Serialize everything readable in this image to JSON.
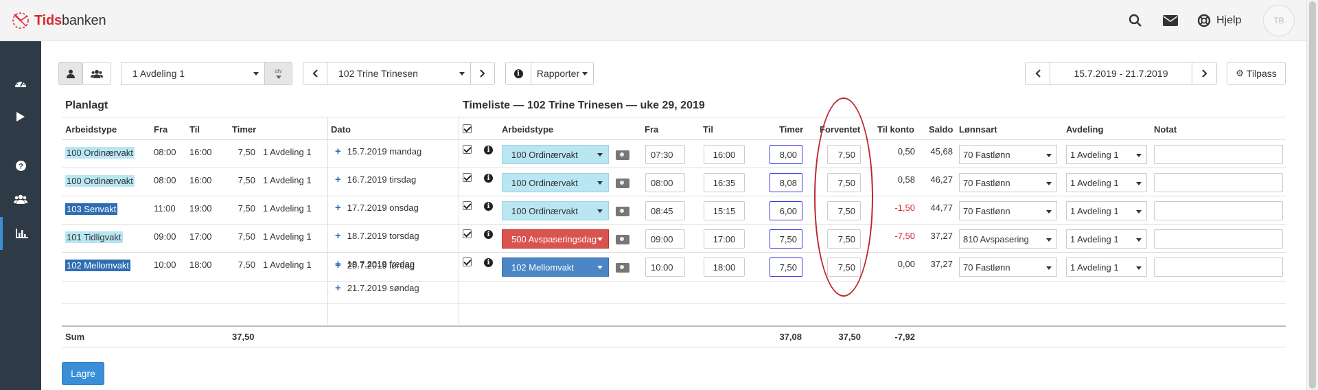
{
  "brand": {
    "name_bold": "Tids",
    "name_rest": "banken"
  },
  "header": {
    "help_label": "Hjelp",
    "avatar_initials": "TB"
  },
  "toolbar": {
    "department_value": "1 Avdeling 1",
    "department_addon": "atv",
    "employee_value": "102 Trine Trinesen",
    "reports_label": "Rapporter",
    "date_range": "15.7.2019 - 21.7.2019",
    "customize_label": "Tilpass"
  },
  "planned": {
    "title": "Planlagt",
    "headers": [
      "Arbeidstype",
      "Fra",
      "Til",
      "Timer",
      "Dato"
    ],
    "rows": [
      {
        "type": "100 Ordinærvakt",
        "fra": "08:00",
        "til": "16:00",
        "timer": "7,50",
        "dept": "1 Avdeling 1",
        "date": "15.7.2019 mandag"
      },
      {
        "type": "100 Ordinærvakt",
        "fra": "08:00",
        "til": "16:00",
        "timer": "7,50",
        "dept": "1 Avdeling 1",
        "date": "16.7.2019 tirsdag"
      },
      {
        "type": "103 Senvakt",
        "fra": "11:00",
        "til": "19:00",
        "timer": "7,50",
        "dept": "1 Avdeling 1",
        "date": "17.7.2019 onsdag"
      },
      {
        "type": "101 Tidligvakt",
        "fra": "09:00",
        "til": "17:00",
        "timer": "7,50",
        "dept": "1 Avdeling 1",
        "date": "18.7.2019 torsdag"
      },
      {
        "type": "102 Mellomvakt",
        "fra": "10:00",
        "til": "18:00",
        "timer": "7,50",
        "dept": "1 Avdeling 1",
        "date": "19.7.2019 fredag"
      }
    ],
    "extra_dates": [
      "20.7.2019 lørdag",
      "21.7.2019 søndag"
    ],
    "sum_label": "Sum",
    "sum_timer": "37,50"
  },
  "timesheet": {
    "title": "Timeliste — 102 Trine Trinesen — uke 29, 2019",
    "headers": [
      "Arbeidstype",
      "Fra",
      "Til",
      "Timer",
      "Forventet",
      "Til konto",
      "Saldo",
      "Lønnsart",
      "Avdeling",
      "Notat"
    ],
    "rows": [
      {
        "type": "100 Ordinærvakt",
        "fra": "07:30",
        "til": "16:00",
        "timer": "8,00",
        "forventet": "7,50",
        "konto": "0,50",
        "saldo": "45,68",
        "lonnsart": "70 Fastlønn",
        "avdeling": "1 Avdeling 1"
      },
      {
        "type": "100 Ordinærvakt",
        "fra": "08:00",
        "til": "16:35",
        "timer": "8,08",
        "forventet": "7,50",
        "konto": "0,58",
        "saldo": "46,27",
        "lonnsart": "70 Fastlønn",
        "avdeling": "1 Avdeling 1"
      },
      {
        "type": "100 Ordinærvakt",
        "fra": "08:45",
        "til": "15:15",
        "timer": "6,00",
        "forventet": "7,50",
        "konto": "-1,50",
        "saldo": "44,77",
        "lonnsart": "70 Fastlønn",
        "avdeling": "1 Avdeling 1"
      },
      {
        "type": "500 Avspaseringsdag",
        "fra": "09:00",
        "til": "17:00",
        "timer": "7,50",
        "forventet": "7,50",
        "konto": "-7,50",
        "saldo": "37,27",
        "lonnsart": "810 Avspasering",
        "avdeling": "1 Avdeling 1"
      },
      {
        "type": "102 Mellomvakt",
        "fra": "10:00",
        "til": "18:00",
        "timer": "7,50",
        "forventet": "7,50",
        "konto": "0,00",
        "saldo": "37,27",
        "lonnsart": "70 Fastlønn",
        "avdeling": "1 Avdeling 1"
      }
    ],
    "sum_timer": "37,08",
    "sum_forventet": "37,50",
    "sum_konto": "-7,92"
  },
  "save_label": "Lagre",
  "colors": {
    "accent": "#3a8fd8",
    "sidebar": "#2e3b47",
    "light_type": "#b9e6f3",
    "red_type": "#d9534f",
    "blue_type": "#4a86c5",
    "negative": "#d9282f",
    "annotation": "#c0272d"
  },
  "icons": [
    "search-icon",
    "mail-icon",
    "lifebuoy-icon",
    "dashboard-icon",
    "play-icon",
    "question-icon",
    "users-icon",
    "bar-chart-icon",
    "user-icon",
    "group-icon",
    "chevron-left-icon",
    "chevron-right-icon",
    "info-icon",
    "gear-icon",
    "camera-icon"
  ]
}
